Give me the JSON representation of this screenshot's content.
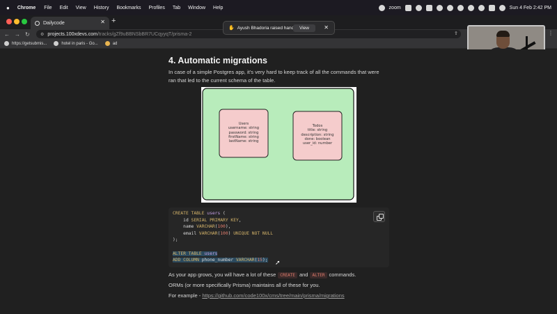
{
  "menubar": {
    "app": "Chrome",
    "items": [
      "File",
      "Edit",
      "View",
      "History",
      "Bookmarks",
      "Profiles",
      "Tab",
      "Window",
      "Help"
    ],
    "zoom": "zoom",
    "datetime": "Sun 4 Feb  2:42 PM"
  },
  "tab": {
    "title": "Dailycode",
    "close": "✕",
    "new": "+"
  },
  "url": {
    "host": "projects.100xdevs.com",
    "path": "/tracks/gZf9uBBNSbBR7UCqyyqT/prisma-2"
  },
  "bookmarks": [
    "https://getsubmis...",
    "hotel in paris - Go...",
    "ad"
  ],
  "notification": {
    "text": "Ayush Bhadoria raised hand",
    "action": "View",
    "close": "✕"
  },
  "article": {
    "heading": "4. Automatic migrations",
    "intro": "In case of a simple Postgres app, it’s very hard to keep track of all the commands that were ran that led to the current schema of the table.",
    "diagram": {
      "users": [
        "Users",
        "username: string",
        "password: string",
        "firstName: string",
        "lastName: string"
      ],
      "todos": [
        "Todos",
        "title: string",
        "description: string",
        "done: boolean",
        "user_id: number"
      ]
    },
    "code": {
      "l1_kw": "CREATE TABLE ",
      "l1_tb": "users",
      "l1_tx": " (",
      "l2_tx": "    id ",
      "l2_kw": "SERIAL PRIMARY KEY",
      "l2_end": ",",
      "l3_tx": "    name ",
      "l3_kw": "VARCHAR",
      "l3_p1": "(",
      "l3_n": "100",
      "l3_p2": "),",
      "l4_tx": "    email ",
      "l4_kw": "VARCHAR",
      "l4_p1": "(",
      "l4_n": "100",
      "l4_p2": ") ",
      "l4_kw2": "UNIQUE NOT NULL",
      "l5_tx": ");",
      "l7_kw": "ALTER TABLE ",
      "l7_tb": "users",
      "l8_kw": "ADD COLUMN ",
      "l8_tx": "phone_number ",
      "l8_kw2": "VARCHAR",
      "l8_p1": "(",
      "l8_n": "15",
      "l8_p2": ");"
    },
    "p1_pre": "As your app grows, you will have a lot of these",
    "p1_chip1": "CREATE",
    "p1_and": "and",
    "p1_chip2": "ALTER",
    "p1_post": "commands.",
    "p2": "ORMs (or more specifically Prisma) maintains all of these for you.",
    "p3_pre": "For example - ",
    "p3_link": "https://github.com/code100x/cms/tree/main/prisma/migrations"
  }
}
